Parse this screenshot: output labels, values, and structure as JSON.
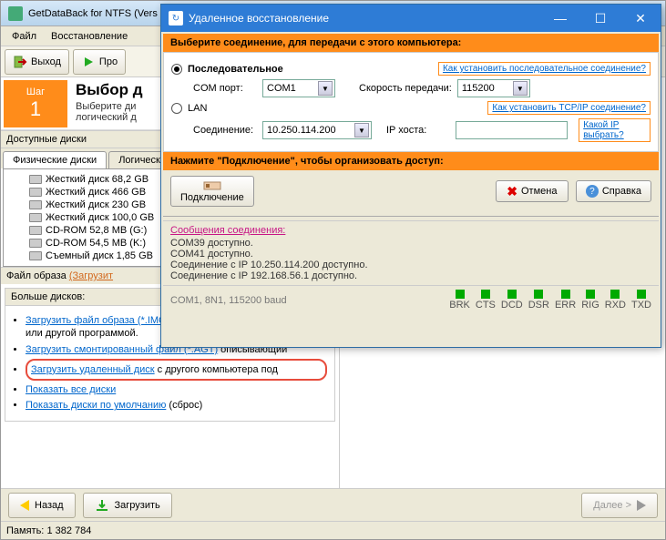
{
  "main": {
    "title": "GetDataBack for NTFS (Vers",
    "menu": {
      "file": "Файл",
      "recovery": "Восстановление"
    },
    "toolbar": {
      "exit": "Выход",
      "check": "Про"
    },
    "step": {
      "label": "Шаг",
      "num": "1",
      "heading": "Выбор д",
      "sub1": "Выберите ди",
      "sub2": "логический д"
    },
    "avail_disks": "Доступные диски",
    "tabs": {
      "phys": "Физические диски",
      "log": "Логические диски"
    },
    "disks": [
      "Жесткий диск 68,2 GB",
      "Жесткий диск 466 GB",
      "Жесткий диск 230 GB",
      "Жесткий диск 100,0 GB",
      "CD-ROM 52,8 MB (G:)",
      "CD-ROM 54,5 MB (K:)",
      "Съемный диск 1,85 GB"
    ],
    "image_file": {
      "label": "Файл образа",
      "link": "(Загрузит"
    },
    "more_hdr": "Больше дисков:",
    "links": {
      "img1": "Загрузить файл образа (*.IMG)",
      "img1_tail": " ранее созданный GetDataBack или другой программой.",
      "mount": "Загрузить смонтированный файл (*.AGT)",
      "mount_tail": " описывающий",
      "remote": "Загрузить удаленный диск",
      "remote_tail": " с другого компьютера под",
      "all": "Показать все диски",
      "default": "Показать диски по умолчанию",
      "default_tail": " (сброс)"
    },
    "nav": {
      "back": "Назад",
      "load": "Загрузить",
      "next": "Далее >"
    },
    "status": {
      "mem_label": "Память:",
      "mem_val": "1 382 784"
    }
  },
  "dialog": {
    "title": "Удаленное восстановление",
    "select_hdr": "Выберите соединение, для передачи с этого компьютера:",
    "serial": "Последовательное",
    "serial_help": "Как установить последовательное соединение?",
    "com_port": "COM порт:",
    "com_val": "COM1",
    "speed": "Скорость передачи:",
    "speed_val": "115200",
    "lan": "LAN",
    "lan_help": "Как установить TCP/IP соединение?",
    "conn": "Соединение:",
    "conn_val": "10.250.114.200",
    "ip_host": "IP хоста:",
    "ip_val": "",
    "ip_help": "Какой IP выбрать?",
    "press_hdr": "Нажмите \"Подключение\", чтобы организовать доступ:",
    "btn_connect": "Подключение",
    "btn_cancel": "Отмена",
    "btn_help": "Справка",
    "log_hdr": "Сообщения соединения:",
    "log": [
      "COM39 доступно.",
      "COM41 доступно.",
      "Соединение с IP 10.250.114.200 доступно.",
      "Соединение с IP 192.168.56.1 доступно."
    ],
    "status": "COM1, 8N1, 115200 baud",
    "leds": [
      "BRK",
      "CTS",
      "DCD",
      "DSR",
      "ERR",
      "RIG",
      "RXD",
      "TXD"
    ]
  }
}
